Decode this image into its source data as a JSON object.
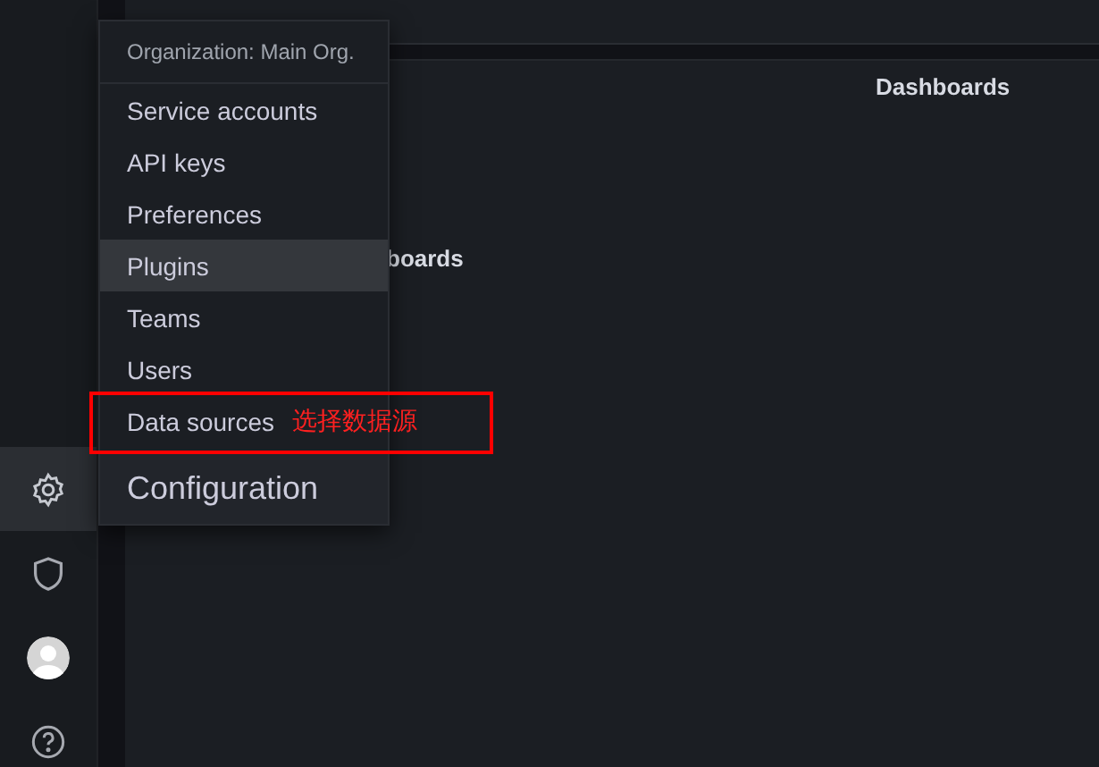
{
  "sidebar": {
    "items": [
      {
        "kind": "settings",
        "selected": true
      },
      {
        "kind": "shield",
        "selected": false
      },
      {
        "kind": "avatar",
        "selected": false
      },
      {
        "kind": "help",
        "selected": false
      }
    ]
  },
  "main": {
    "headings": [
      "Dashboards",
      "boards"
    ]
  },
  "menu": {
    "header": "Organization: Main Org.",
    "items": [
      {
        "label": "Service accounts",
        "selected": false
      },
      {
        "label": "API keys",
        "selected": false
      },
      {
        "label": "Preferences",
        "selected": false
      },
      {
        "label": "Plugins",
        "selected": true
      },
      {
        "label": "Teams",
        "selected": false
      },
      {
        "label": "Users",
        "selected": false
      },
      {
        "label": "Data sources",
        "selected": false,
        "annotation": "选择数据源"
      }
    ],
    "title": "Configuration"
  }
}
